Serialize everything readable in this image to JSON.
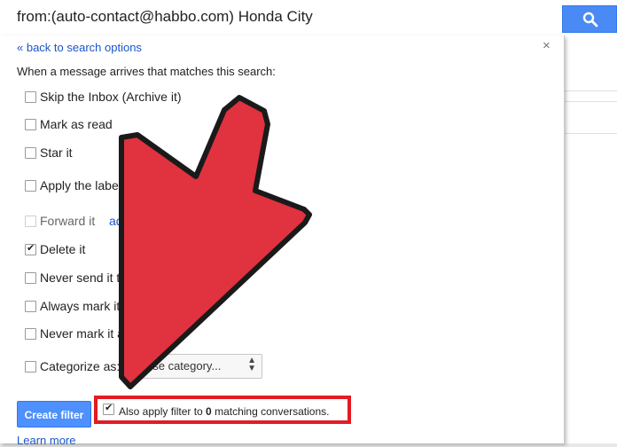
{
  "search": {
    "query": "from:(auto-contact@habbo.com) Honda City",
    "button_icon": "search-icon"
  },
  "filter": {
    "back_link": "« back to search options",
    "close_label": "×",
    "instruction": "When a message arrives that matches this search:",
    "options": [
      {
        "label": "Skip the Inbox (Archive it)",
        "checked": false
      },
      {
        "label": "Mark as read",
        "checked": false
      },
      {
        "label": "Star it",
        "checked": false
      },
      {
        "label": "Apply the label",
        "checked": false
      },
      {
        "label": "Forward it",
        "checked": false,
        "disabled": true,
        "link": "ad"
      },
      {
        "label": "Delete it",
        "checked": true
      },
      {
        "label": "Never send it to",
        "checked": false
      },
      {
        "label": "Always mark it",
        "checked": false
      },
      {
        "label": "Never mark it a",
        "checked": false
      },
      {
        "label": "Categorize as:",
        "checked": false,
        "select": "ose category..."
      }
    ],
    "create_button": "Create filter",
    "also_apply_prefix": "Also apply filter to ",
    "also_apply_count": "0",
    "also_apply_suffix": " matching conversations.",
    "also_apply_checked": true,
    "learn_more": "Learn more"
  },
  "colors": {
    "accent_blue": "#4d90fe",
    "link_blue": "#1a55c9",
    "arrow_red": "#e0323f",
    "highlight_red": "#e31b23"
  }
}
